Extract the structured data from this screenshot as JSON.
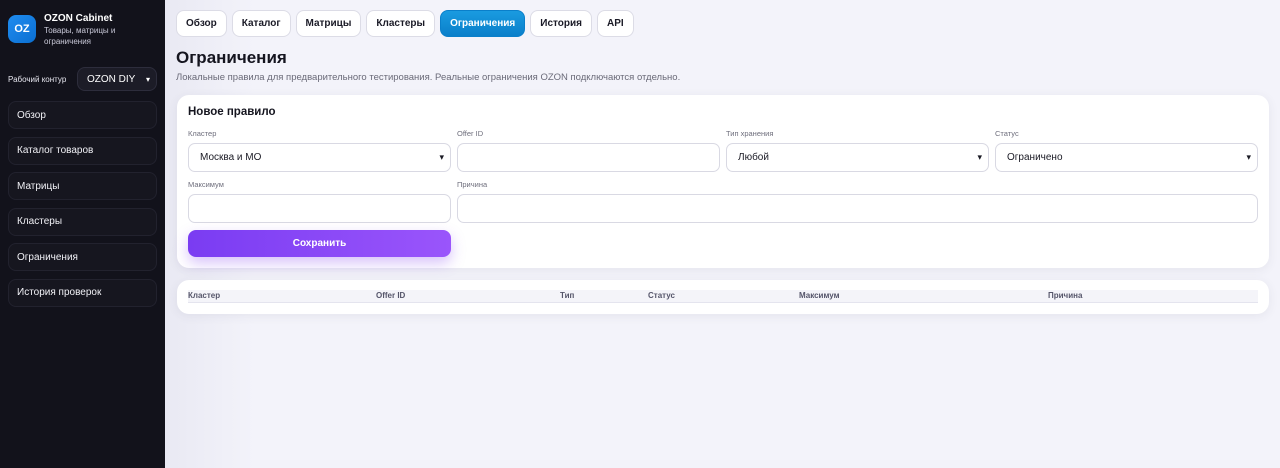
{
  "brand": {
    "logo": "OZ",
    "title": "OZON Cabinet",
    "subtitle": "Товары, матрицы и ограничения"
  },
  "workspace": {
    "label": "Рабочий контур",
    "selected": "OZON DIY"
  },
  "sidebar": {
    "items": [
      {
        "label": "Обзор"
      },
      {
        "label": "Каталог товаров"
      },
      {
        "label": "Матрицы"
      },
      {
        "label": "Кластеры"
      },
      {
        "label": "Ограничения"
      },
      {
        "label": "История проверок"
      }
    ]
  },
  "tabs": [
    {
      "label": "Обзор",
      "active": false
    },
    {
      "label": "Каталог",
      "active": false
    },
    {
      "label": "Матрицы",
      "active": false
    },
    {
      "label": "Кластеры",
      "active": false
    },
    {
      "label": "Ограничения",
      "active": true
    },
    {
      "label": "История",
      "active": false
    },
    {
      "label": "API",
      "active": false
    }
  ],
  "page": {
    "title": "Ограничения",
    "description": "Локальные правила для предварительного тестирования. Реальные ограничения OZON подключаются отдельно."
  },
  "form": {
    "title": "Новое правило",
    "cluster": {
      "label": "Кластер",
      "value": "Москва и МО"
    },
    "offer_id": {
      "label": "Offer ID",
      "value": ""
    },
    "storage_type": {
      "label": "Тип хранения",
      "value": "Любой"
    },
    "status": {
      "label": "Статус",
      "value": "Ограничено"
    },
    "maximum": {
      "label": "Максимум",
      "value": ""
    },
    "reason": {
      "label": "Причина",
      "value": ""
    },
    "save_label": "Сохранить"
  },
  "table": {
    "columns": [
      "Кластер",
      "Offer ID",
      "Тип",
      "Статус",
      "Максимум",
      "Причина"
    ],
    "rows": []
  },
  "colors": {
    "sidebar_bg": "#12121b",
    "accent_tab": "#0a7fca",
    "save_button": "#8a48f7"
  }
}
